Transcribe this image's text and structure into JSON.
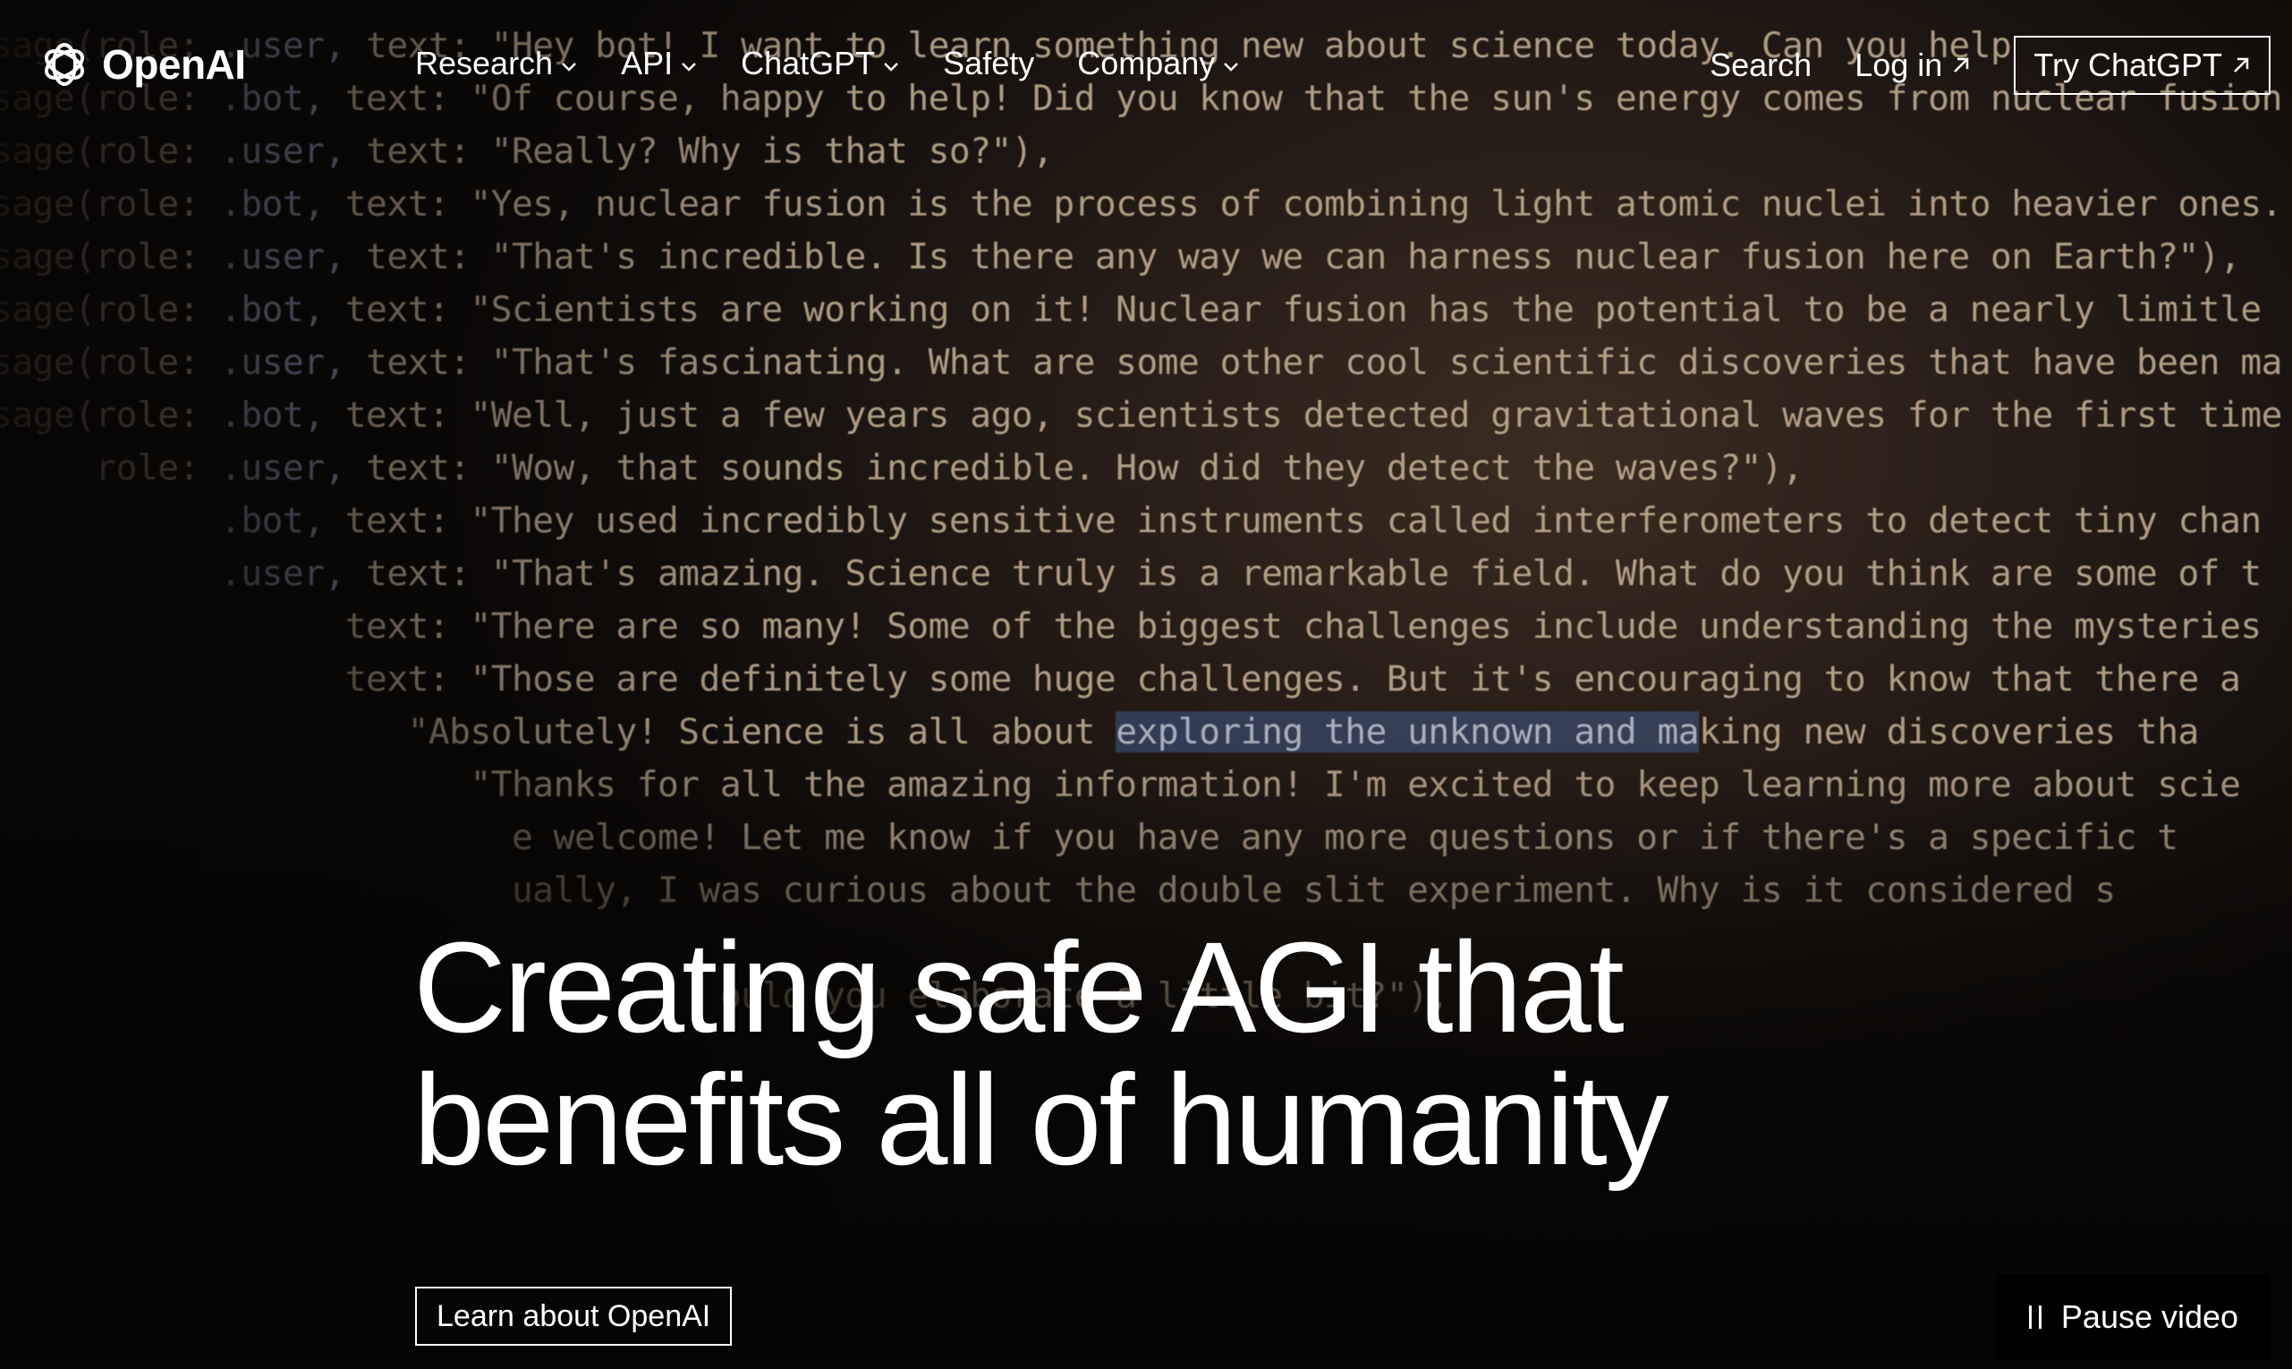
{
  "background": {
    "code_lines": [
      {
        "prefix": "sage(role: ",
        "role": ".user, ",
        "key": "text: ",
        "text": "\"Hey bot! I want to learn something new about science today. Can you help"
      },
      {
        "prefix": "sage(role: ",
        "role": ".bot, ",
        "key": "text: ",
        "text": "\"Of course, happy to help! Did you know that the sun's energy comes from nuclear fusion"
      },
      {
        "prefix": "sage(role: ",
        "role": ".user, ",
        "key": "text: ",
        "text": "\"Really? Why is that so?\"),"
      },
      {
        "prefix": "sage(role: ",
        "role": ".bot, ",
        "key": "text: ",
        "text": "\"Yes, nuclear fusion is the process of combining light atomic nuclei into heavier ones."
      },
      {
        "prefix": "sage(role: ",
        "role": ".user, ",
        "key": "text: ",
        "text": "\"That's incredible. Is there any way we can harness nuclear fusion here on Earth?\"),"
      },
      {
        "prefix": "sage(role: ",
        "role": ".bot, ",
        "key": "text: ",
        "text": "\"Scientists are working on it! Nuclear fusion has the potential to be a nearly limitle"
      },
      {
        "prefix": "sage(role: ",
        "role": ".user, ",
        "key": "text: ",
        "text": "\"That's fascinating. What are some other cool scientific discoveries that have been ma"
      },
      {
        "prefix": "sage(role: ",
        "role": ".bot, ",
        "key": "text: ",
        "text": "\"Well, just a few years ago, scientists detected gravitational waves for the first time"
      },
      {
        "prefix": "     role: ",
        "role": ".user, ",
        "key": "text: ",
        "text": "\"Wow, that sounds incredible. How did they detect the waves?\"),"
      },
      {
        "prefix": "           ",
        "role": ".bot, ",
        "key": "text: ",
        "text": "\"They used incredibly sensitive instruments called interferometers to detect tiny chan"
      },
      {
        "prefix": "           ",
        "role": ".user, ",
        "key": "text: ",
        "text": "\"That's amazing. Science truly is a remarkable field. What do you think are some of t"
      },
      {
        "prefix": "           ",
        "role": "      ",
        "key": "text: ",
        "text": "\"There are so many! Some of the biggest challenges include understanding the mysteries"
      },
      {
        "prefix": "           ",
        "role": "      ",
        "key": "text: ",
        "text": "\"Those are definitely some huge challenges. But it's encouraging to know that there a"
      },
      {
        "prefix": "           ",
        "role": "      ",
        "key": "   ",
        "text": "\"Absolutely! Science is all about ",
        "selected": "exploring the unknown and ma",
        "after": "king new discoveries tha"
      },
      {
        "prefix": "           ",
        "role": "      ",
        "key": "      ",
        "text": "\"Thanks for all the amazing information! I'm excited to keep learning more about scie"
      },
      {
        "prefix": "           ",
        "role": "      ",
        "key": "      ",
        "text": "  e welcome! Let me know if you have any more questions or if there's a specific t"
      },
      {
        "prefix": "           ",
        "role": "      ",
        "key": "      ",
        "text": "  ually, I was curious about the double slit experiment. Why is it considered s"
      },
      {
        "prefix": "           ",
        "role": "      ",
        "key": "      ",
        "text": ""
      },
      {
        "prefix": "           ",
        "role": "      ",
        "key": "      ",
        "text": "            ould you elaborate a little bit?\"),"
      }
    ]
  },
  "nav": {
    "logo_text": "OpenAI",
    "menu": [
      {
        "label": "Research",
        "dropdown": true
      },
      {
        "label": "API",
        "dropdown": true
      },
      {
        "label": "ChatGPT",
        "dropdown": true
      },
      {
        "label": "Safety",
        "dropdown": false
      },
      {
        "label": "Company",
        "dropdown": true
      }
    ],
    "search_label": "Search",
    "login_label": "Log in",
    "try_label": "Try ChatGPT"
  },
  "hero": {
    "title_line1": "Creating safe AGI that",
    "title_line2": "benefits all of humanity",
    "cta_label": "Learn about OpenAI"
  },
  "video": {
    "pause_label": "Pause video"
  },
  "colors": {
    "text": "#ffffff",
    "background": "#0b0908",
    "selection": "#466eaa"
  }
}
